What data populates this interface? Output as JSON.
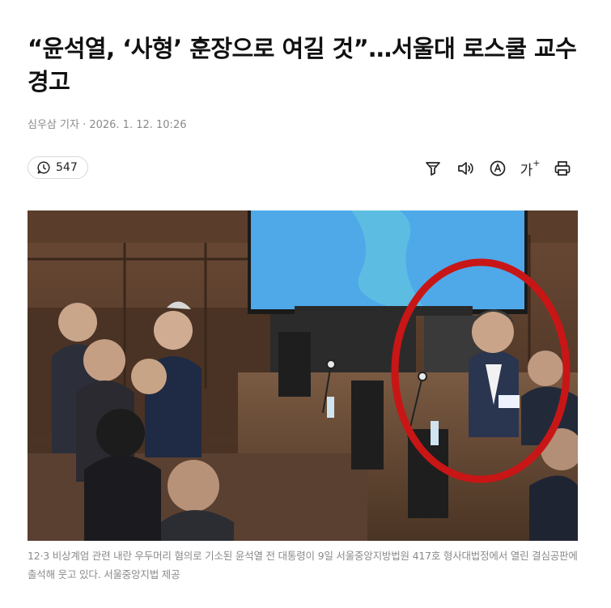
{
  "article": {
    "headline": "“윤석열, ‘사형’ 훈장으로 여길 것”…서울대 로스쿨 교수 경고",
    "byline": "심우삼 기자 · 2026. 1. 12. 10:26",
    "comment_count": "547",
    "caption": "12·3 비상계엄 관련 내란 우두머리 혐의로 기소된 윤석열 전 대통령이 9일 서울중앙지방법원 417호 형사대법정에서 열린 결심공판에 출석해 웃고 있다. 서울중앙지법 제공"
  },
  "toolbar": {
    "icons": [
      "filter-icon",
      "speaker-icon",
      "translate-icon",
      "font-size-icon",
      "print-icon"
    ],
    "font_size_label": "가"
  },
  "colors": {
    "highlight_circle": "#c81616",
    "screen_blue": "#4fa8e8"
  }
}
